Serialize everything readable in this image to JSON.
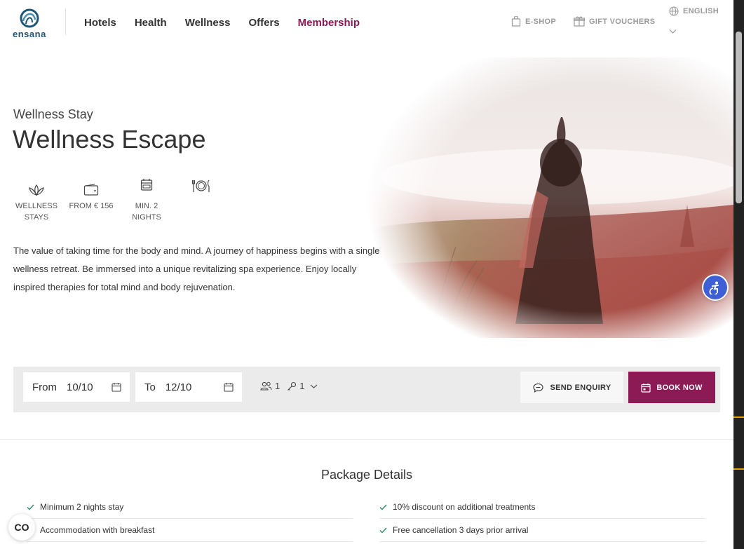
{
  "header": {
    "logo_text": "ensana",
    "nav": [
      "Hotels",
      "Health",
      "Wellness",
      "Offers",
      "Membership"
    ],
    "active_nav": "Membership",
    "eshop": "E-SHOP",
    "gift": "GIFT VOUCHERS",
    "language": "ENGLISH"
  },
  "hero": {
    "eyebrow": "Wellness Stay",
    "title": "Wellness Escape",
    "features": [
      {
        "icon": "lotus-icon",
        "line1": "WELLNESS",
        "line2": "STAYS"
      },
      {
        "icon": "wallet-icon",
        "line1": "FROM € 156",
        "line2": ""
      },
      {
        "icon": "calendar-icon",
        "line1": "MIN. 2",
        "line2": "NIGHTS"
      },
      {
        "icon": "dining-icon",
        "line1": "",
        "line2": ""
      }
    ],
    "description": "The value of taking time for the body and mind. A journey of happiness begins with a single wellness retreat. Be immersed into a unique revitalizing spa experience. Enjoy locally inspired therapies for total mind and body rejuvenation."
  },
  "booking": {
    "from_label": "From",
    "from_value": "10/10",
    "to_label": "To",
    "to_value": "12/10",
    "guests": "1",
    "rooms": "1",
    "enquiry_label": "SEND ENQUIRY",
    "book_label": "BOOK NOW"
  },
  "package": {
    "title": "Package Details",
    "left": [
      "Minimum 2 nights stay",
      "Accommodation with breakfast"
    ],
    "right": [
      "10% discount on additional treatments",
      "Free cancellation 3 days prior arrival"
    ]
  },
  "cookie_label": "CO",
  "colors": {
    "brand": "#8b1a55",
    "logo": "#1e5675",
    "accessibility": "#3e5fd6"
  }
}
